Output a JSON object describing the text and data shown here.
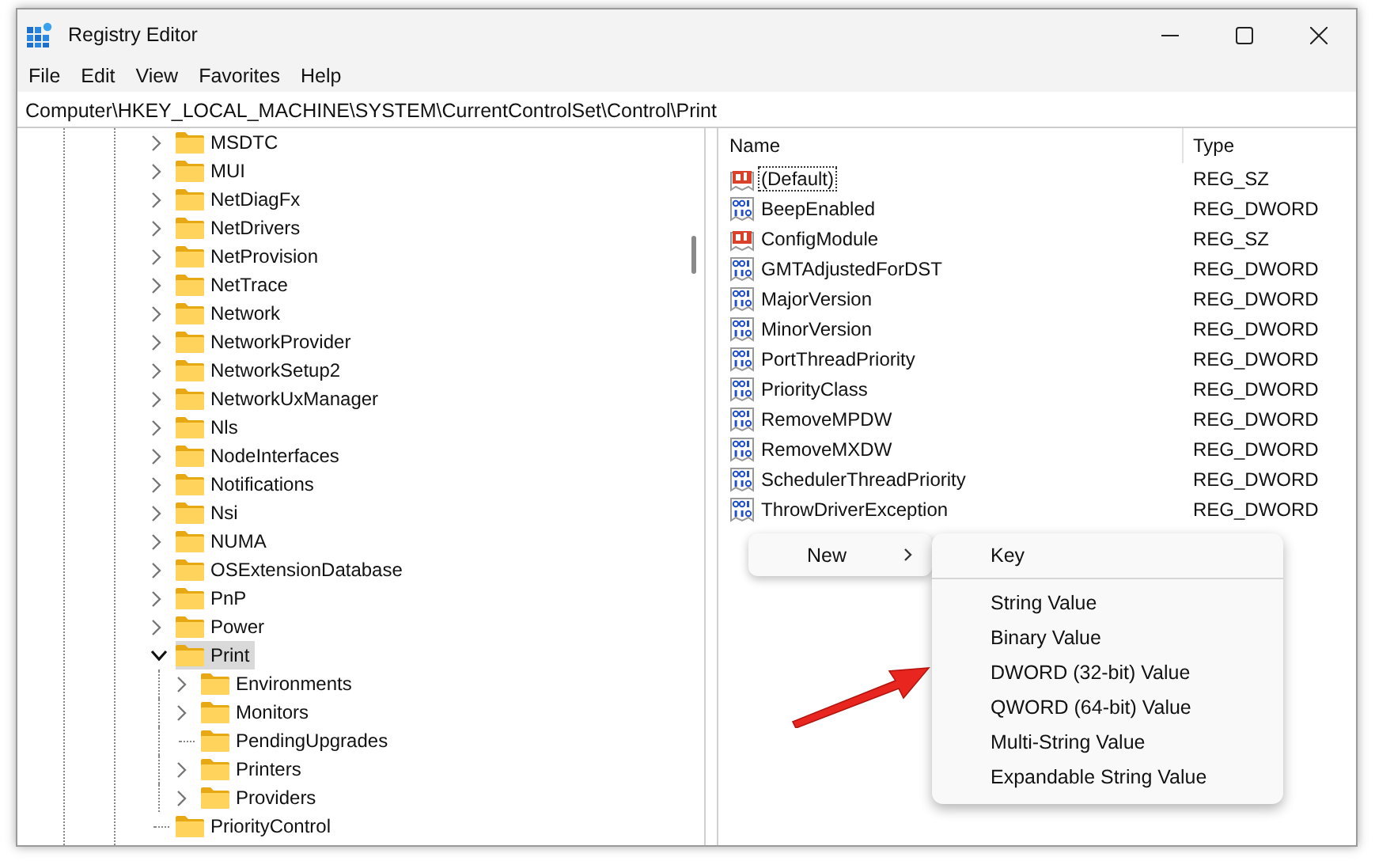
{
  "window": {
    "title": "Registry Editor"
  },
  "menu": [
    "File",
    "Edit",
    "View",
    "Favorites",
    "Help"
  ],
  "address": "Computer\\HKEY_LOCAL_MACHINE\\SYSTEM\\CurrentControlSet\\Control\\Print",
  "tree": [
    {
      "label": "MSDTC",
      "expanded": false,
      "selected": false
    },
    {
      "label": "MUI",
      "expanded": false,
      "selected": false
    },
    {
      "label": "NetDiagFx",
      "expanded": false,
      "selected": false
    },
    {
      "label": "NetDrivers",
      "expanded": false,
      "selected": false
    },
    {
      "label": "NetProvision",
      "expanded": false,
      "selected": false
    },
    {
      "label": "NetTrace",
      "expanded": false,
      "selected": false
    },
    {
      "label": "Network",
      "expanded": false,
      "selected": false
    },
    {
      "label": "NetworkProvider",
      "expanded": false,
      "selected": false
    },
    {
      "label": "NetworkSetup2",
      "expanded": false,
      "selected": false
    },
    {
      "label": "NetworkUxManager",
      "expanded": false,
      "selected": false
    },
    {
      "label": "Nls",
      "expanded": false,
      "selected": false
    },
    {
      "label": "NodeInterfaces",
      "expanded": false,
      "selected": false
    },
    {
      "label": "Notifications",
      "expanded": false,
      "selected": false
    },
    {
      "label": "Nsi",
      "expanded": false,
      "selected": false
    },
    {
      "label": "NUMA",
      "expanded": false,
      "selected": false
    },
    {
      "label": "OSExtensionDatabase",
      "expanded": false,
      "selected": false
    },
    {
      "label": "PnP",
      "expanded": false,
      "selected": false
    },
    {
      "label": "Power",
      "expanded": false,
      "selected": false
    },
    {
      "label": "Print",
      "expanded": true,
      "selected": true,
      "children": [
        {
          "label": "Environments",
          "expanded": false,
          "selected": false
        },
        {
          "label": "Monitors",
          "expanded": false,
          "selected": false
        },
        {
          "label": "PendingUpgrades",
          "selected": false
        },
        {
          "label": "Printers",
          "expanded": false,
          "selected": false
        },
        {
          "label": "Providers",
          "expanded": false,
          "selected": false
        }
      ]
    },
    {
      "label": "PriorityControl",
      "selected": false
    }
  ],
  "values": {
    "columns": [
      "Name",
      "Type"
    ],
    "rows": [
      {
        "name": "(Default)",
        "type": "REG_SZ",
        "kind": "string",
        "focused": true
      },
      {
        "name": "BeepEnabled",
        "type": "REG_DWORD",
        "kind": "binary",
        "focused": false
      },
      {
        "name": "ConfigModule",
        "type": "REG_SZ",
        "kind": "string",
        "focused": false
      },
      {
        "name": "GMTAdjustedForDST",
        "type": "REG_DWORD",
        "kind": "binary",
        "focused": false
      },
      {
        "name": "MajorVersion",
        "type": "REG_DWORD",
        "kind": "binary",
        "focused": false
      },
      {
        "name": "MinorVersion",
        "type": "REG_DWORD",
        "kind": "binary",
        "focused": false
      },
      {
        "name": "PortThreadPriority",
        "type": "REG_DWORD",
        "kind": "binary",
        "focused": false
      },
      {
        "name": "PriorityClass",
        "type": "REG_DWORD",
        "kind": "binary",
        "focused": false
      },
      {
        "name": "RemoveMPDW",
        "type": "REG_DWORD",
        "kind": "binary",
        "focused": false
      },
      {
        "name": "RemoveMXDW",
        "type": "REG_DWORD",
        "kind": "binary",
        "focused": false
      },
      {
        "name": "SchedulerThreadPriority",
        "type": "REG_DWORD",
        "kind": "binary",
        "focused": false
      },
      {
        "name": "ThrowDriverException",
        "type": "REG_DWORD",
        "kind": "binary",
        "focused": false
      }
    ]
  },
  "context_menu": {
    "items": [
      {
        "label": "New",
        "has_submenu": true
      }
    ]
  },
  "submenu": {
    "items": [
      {
        "kind": "item",
        "label": "Key"
      },
      {
        "kind": "separator"
      },
      {
        "kind": "item",
        "label": "String Value"
      },
      {
        "kind": "item",
        "label": "Binary Value"
      },
      {
        "kind": "item",
        "label": "DWORD (32-bit) Value"
      },
      {
        "kind": "item",
        "label": "QWORD (64-bit) Value"
      },
      {
        "kind": "item",
        "label": "Multi-String Value"
      },
      {
        "kind": "item",
        "label": "Expandable String Value"
      }
    ]
  }
}
